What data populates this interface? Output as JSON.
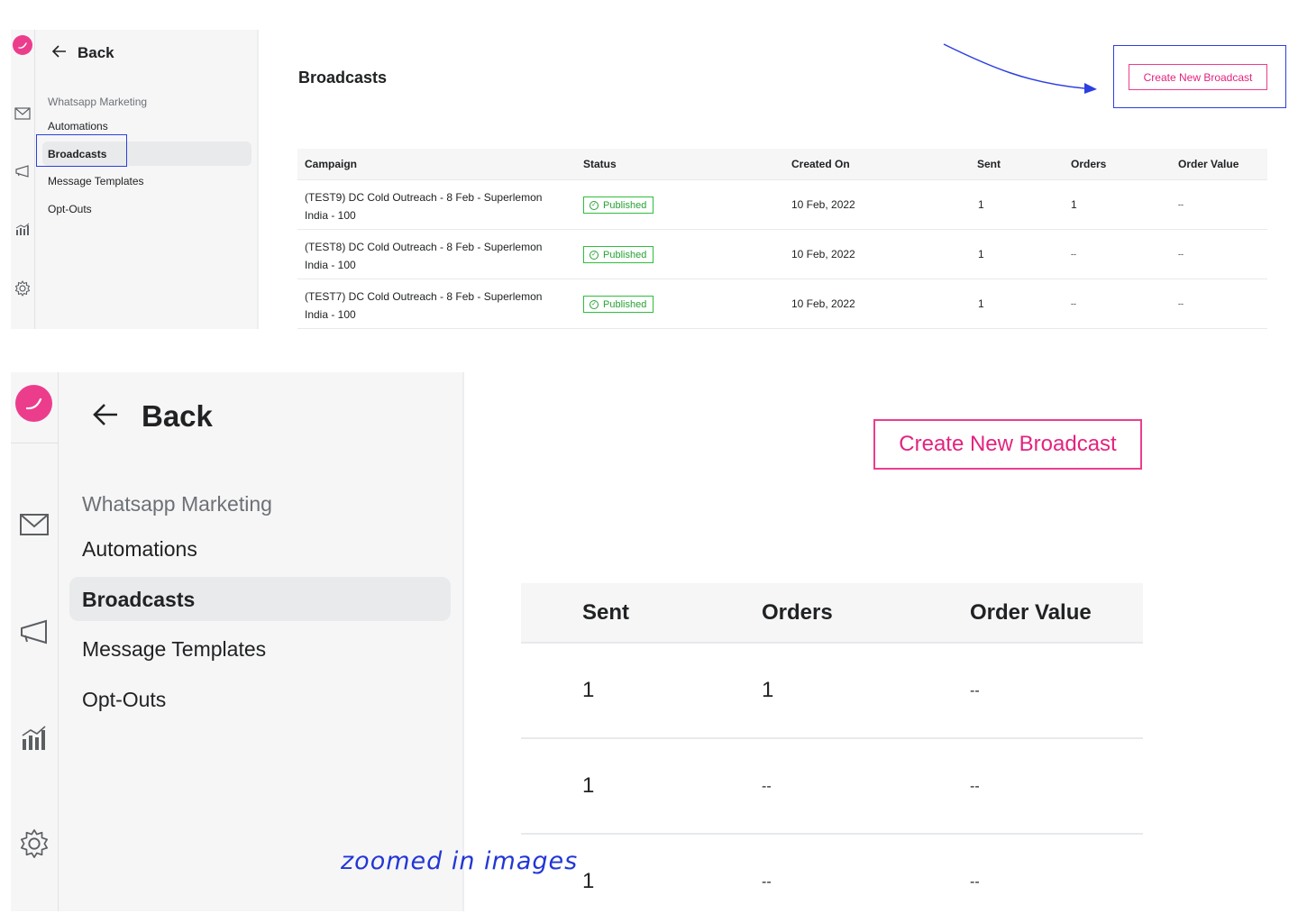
{
  "back_label": "Back",
  "sidebar": {
    "section_label": "Whatsapp Marketing",
    "items": [
      {
        "label": "Automations",
        "active": false
      },
      {
        "label": "Broadcasts",
        "active": true
      },
      {
        "label": "Message Templates",
        "active": false
      },
      {
        "label": "Opt-Outs",
        "active": false
      }
    ]
  },
  "rail_icons": [
    "mail-icon",
    "megaphone-icon",
    "analytics-icon",
    "gear-icon"
  ],
  "page_title": "Broadcasts",
  "create_button_label": "Create New Broadcast",
  "table": {
    "columns": [
      "Campaign",
      "Status",
      "Created On",
      "Sent",
      "Orders",
      "Order Value"
    ],
    "rows": [
      {
        "campaign": "(TEST9) DC Cold Outreach - 8 Feb - Superlemon India - 100",
        "status": "Published",
        "created_on": "10 Feb, 2022",
        "sent": "1",
        "orders": "1",
        "order_value": "--"
      },
      {
        "campaign": "(TEST8) DC Cold Outreach - 8 Feb - Superlemon India - 100",
        "status": "Published",
        "created_on": "10 Feb, 2022",
        "sent": "1",
        "orders": "--",
        "order_value": "--"
      },
      {
        "campaign": "(TEST7) DC Cold Outreach - 8 Feb - Superlemon India - 100",
        "status": "Published",
        "created_on": "10 Feb, 2022",
        "sent": "1",
        "orders": "--",
        "order_value": "--"
      }
    ]
  },
  "annotation_caption": "zoomed in images",
  "colors": {
    "brand_pink": "#ec3d8d",
    "published_green": "#27a334",
    "annotation_blue": "#2c3fe0",
    "sidebar_bg": "#f6f6f7"
  }
}
